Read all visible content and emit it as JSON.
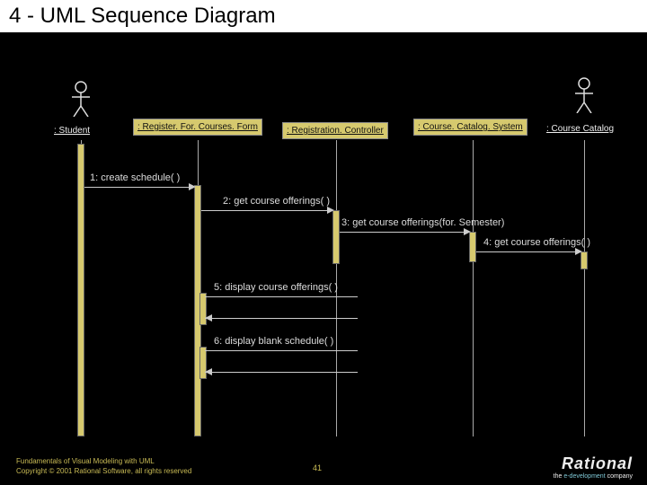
{
  "title": "4 - UML Sequence Diagram",
  "participants": {
    "student": ": Student",
    "form": ": Register. For. Courses. Form",
    "controller": ": Registration. Controller",
    "catalogSystem": ": Course. Catalog. System",
    "catalog": ": Course Catalog"
  },
  "messages": {
    "m1": "1: create schedule( )",
    "m2": "2: get course offerings( )",
    "m3": "3: get course offerings(for. Semester)",
    "m4": "4: get course offerings( )",
    "m5": "5: display course offerings( )",
    "m6": "6: display blank schedule( )"
  },
  "footer": {
    "line1": "Fundamentals of Visual Modeling with UML",
    "line2": "Copyright © 2001 Rational Software, all rights reserved",
    "page": "41"
  },
  "logo": {
    "name": "Rational",
    "tag_pre": "the ",
    "tag_em": "e-development",
    "tag_post": " company"
  },
  "chart_data": {
    "type": "table",
    "diagram_kind": "uml-sequence",
    "participants": [
      {
        "id": "student",
        "label": ": Student",
        "kind": "actor"
      },
      {
        "id": "form",
        "label": ": Register. For. Courses. Form",
        "kind": "object"
      },
      {
        "id": "controller",
        "label": ": Registration. Controller",
        "kind": "object"
      },
      {
        "id": "catalogSystem",
        "label": ": Course. Catalog. System",
        "kind": "object"
      },
      {
        "id": "catalog",
        "label": ": Course Catalog",
        "kind": "actor"
      }
    ],
    "messages": [
      {
        "seq": 1,
        "from": "student",
        "to": "form",
        "label": "create schedule( )",
        "return": false
      },
      {
        "seq": 2,
        "from": "form",
        "to": "controller",
        "label": "get course offerings( )",
        "return": false
      },
      {
        "seq": 3,
        "from": "controller",
        "to": "catalogSystem",
        "label": "get course offerings(for. Semester)",
        "return": false
      },
      {
        "seq": 4,
        "from": "catalogSystem",
        "to": "catalog",
        "label": "get course offerings( )",
        "return": false
      },
      {
        "seq": 5,
        "from": "form",
        "to": "form",
        "label": "display course offerings( )",
        "return": true
      },
      {
        "seq": 6,
        "from": "form",
        "to": "form",
        "label": "display blank schedule( )",
        "return": true
      }
    ]
  }
}
